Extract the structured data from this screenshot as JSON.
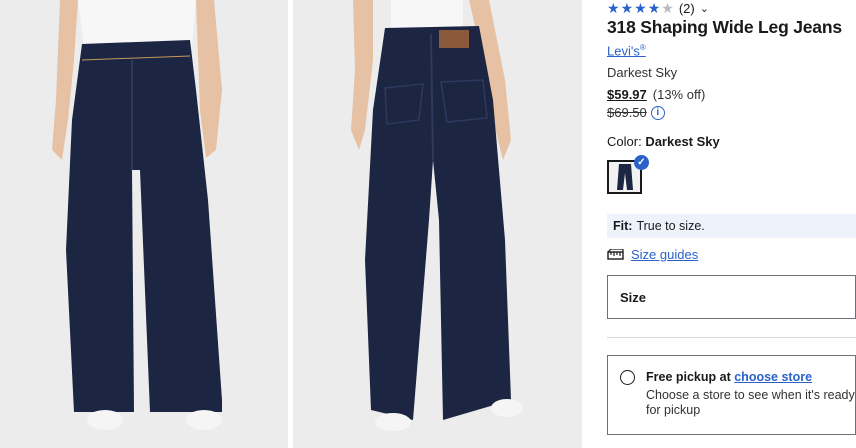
{
  "product": {
    "rating_value": 4,
    "rating_count": "(2)",
    "rating_chevron_icon": "chevron-down-icon",
    "title": "318 Shaping Wide Leg Jeans",
    "brand": "Levi's",
    "brand_mark": "®",
    "color_name": "Darkest Sky",
    "price": "$59.97",
    "discount": "(13% off)",
    "original_price": "$69.50",
    "price_info_icon": "info-icon"
  },
  "color": {
    "label": "Color:",
    "selected": "Darkest Sky",
    "swatch_selected": true
  },
  "fit": {
    "label": "Fit:",
    "value": "True to size."
  },
  "size_guides": {
    "icon": "ruler-icon",
    "label": "Size guides"
  },
  "size": {
    "label": "Size"
  },
  "pickup": {
    "title_prefix": "Free pickup at",
    "store_link": "choose store",
    "description": "Choose a store to see when it's ready for pickup"
  },
  "colors": {
    "accent": "#2b62c9",
    "denim": "#1c2541",
    "photo_bg": "#ececec"
  }
}
